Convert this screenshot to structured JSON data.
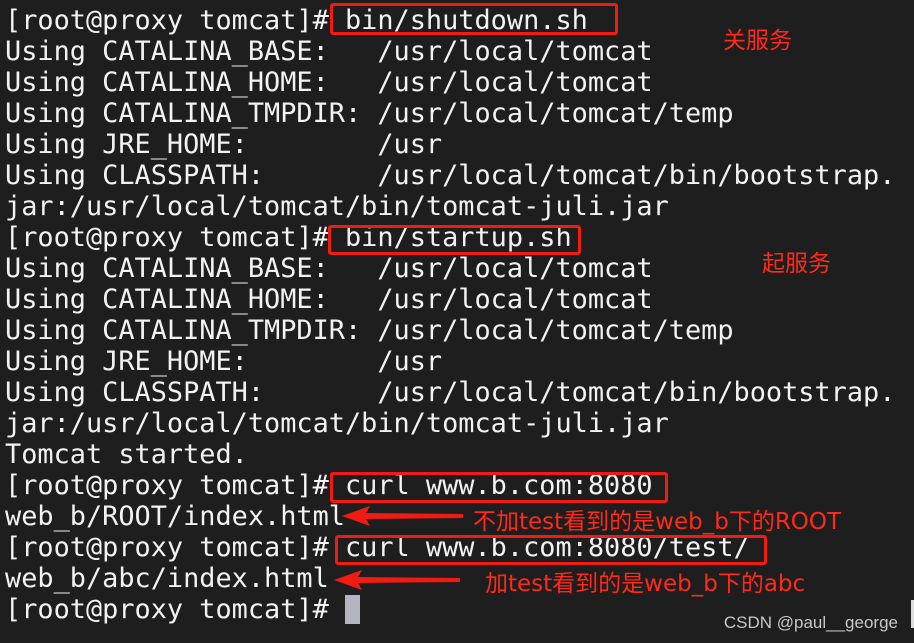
{
  "terminal": {
    "lines": [
      "[root@proxy tomcat]# bin/shutdown.sh",
      "Using CATALINA_BASE:   /usr/local/tomcat",
      "Using CATALINA_HOME:   /usr/local/tomcat",
      "Using CATALINA_TMPDIR: /usr/local/tomcat/temp",
      "Using JRE_HOME:        /usr",
      "Using CLASSPATH:       /usr/local/tomcat/bin/bootstrap.",
      "jar:/usr/local/tomcat/bin/tomcat-juli.jar",
      "[root@proxy tomcat]# bin/startup.sh",
      "Using CATALINA_BASE:   /usr/local/tomcat",
      "Using CATALINA_HOME:   /usr/local/tomcat",
      "Using CATALINA_TMPDIR: /usr/local/tomcat/temp",
      "Using JRE_HOME:        /usr",
      "Using CLASSPATH:       /usr/local/tomcat/bin/bootstrap.",
      "jar:/usr/local/tomcat/bin/tomcat-juli.jar",
      "Tomcat started.",
      "[root@proxy tomcat]# curl www.b.com:8080",
      "web_b/ROOT/index.html",
      "[root@proxy tomcat]# curl www.b.com:8080/test/",
      "web_b/abc/index.html"
    ],
    "prompt": "[root@proxy tomcat]# "
  },
  "annotations": {
    "shutdown": "关服务",
    "startup": "起服务",
    "root_note": "不加test看到的是web_b下的ROOT",
    "abc_note": "加test看到的是web_b下的abc"
  },
  "watermark": "CSDN @paul__george",
  "colors": {
    "background": "#1e1e1e",
    "text": "#f2f2f2",
    "annotation": "#ff2a1a"
  }
}
